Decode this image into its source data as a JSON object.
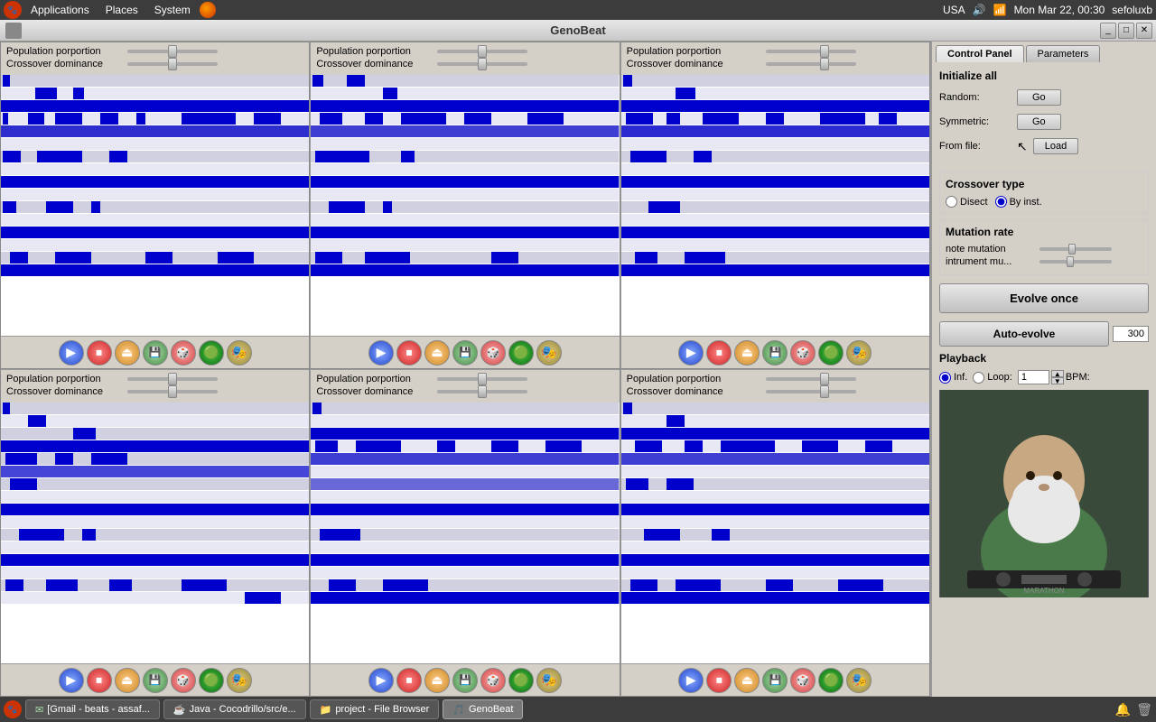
{
  "menubar": {
    "apps_label": "Applications",
    "places_label": "Places",
    "system_label": "System",
    "right": {
      "country": "USA",
      "time": "Mon Mar 22, 00:30",
      "user": "sefoluxb"
    }
  },
  "titlebar": {
    "title": "GenoBeat",
    "minimize": "_",
    "maximize": "□",
    "close": "✕"
  },
  "panels": {
    "rows": [
      [
        {
          "id": "p1",
          "population_label": "Population porportion",
          "crossover_label": "Crossover dominance"
        },
        {
          "id": "p2",
          "population_label": "Population porportion",
          "crossover_label": "Crossover dominance"
        },
        {
          "id": "p3",
          "population_label": "Population porportion",
          "crossover_label": "Crossover dominance"
        }
      ],
      [
        {
          "id": "p4",
          "population_label": "Population porportion",
          "crossover_label": "Crossover dominance"
        },
        {
          "id": "p5",
          "population_label": "Population porportion",
          "crossover_label": "Crossover dominance"
        },
        {
          "id": "p6",
          "population_label": "Population porportion",
          "crossover_label": "Crossover dominance"
        }
      ]
    ],
    "toolbar_buttons": {
      "play": "▶",
      "stop": "⏹",
      "eject": "⏏",
      "save": "💾",
      "dice": "🎲",
      "blob": "🟢",
      "merge": "🎭"
    }
  },
  "right_panel": {
    "tab1": "Control Panel",
    "tab2": "Parameters",
    "initialize_all": "Initialize all",
    "random_label": "Random:",
    "symmetric_label": "Symmetric:",
    "from_file_label": "From file:",
    "go_label": "Go",
    "load_label": "Load",
    "crossover_type_label": "Crossover type",
    "disect_label": "Disect",
    "by_inst_label": "By inst.",
    "mutation_rate_label": "Mutation rate",
    "note_mutation_label": "note mutation",
    "intrument_mu_label": "intrument mu...",
    "evolve_once_label": "Evolve once",
    "auto_evolve_label": "Auto-evolve",
    "auto_evolve_value": "300",
    "playback_label": "Playback",
    "inf_label": "Inf.",
    "loop_label": "Loop:",
    "bpm_value": "1",
    "bpm_label": "BPM:"
  },
  "taskbar": {
    "items": [
      {
        "label": "[Gmail - beats - assaf...",
        "icon": "email"
      },
      {
        "label": "Java - Cocodrillo/src/e...",
        "icon": "java"
      },
      {
        "label": "project - File Browser",
        "icon": "folder"
      },
      {
        "label": "GenoBeat",
        "icon": "app",
        "active": true
      }
    ]
  }
}
